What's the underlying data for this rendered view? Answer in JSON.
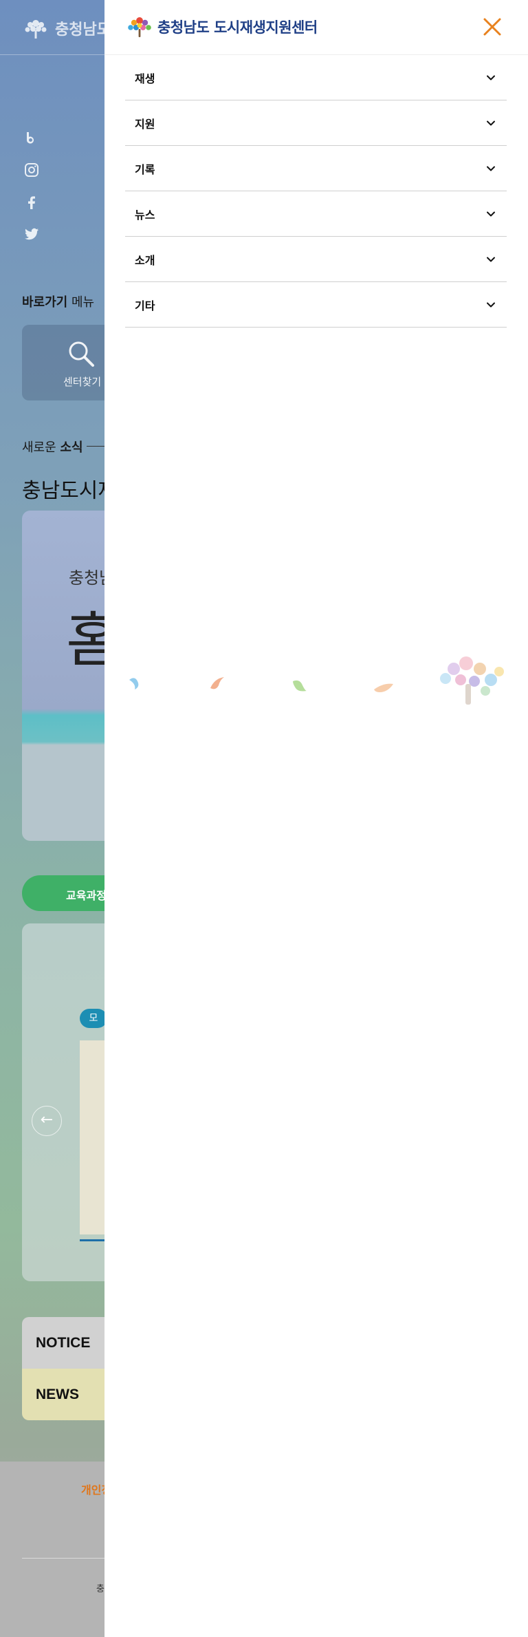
{
  "background": {
    "logo_text": "충청남도",
    "social_icons": [
      "blog-icon",
      "instagram-icon",
      "facebook-icon",
      "twitter-icon"
    ],
    "quick_title_bold": "바로가기",
    "quick_title_rest": " 메뉴",
    "quick_card_label": "센터찾기",
    "news_title_normal": "새로운 ",
    "news_title_bold": "소식",
    "big_title": "충남도시재",
    "banner_line1": "충청남",
    "banner_line2": "홈",
    "green_button": "교육과정",
    "edu_badge": "모",
    "tabs": [
      "NOTICE",
      "NEWS"
    ],
    "footer_privacy": "개인정",
    "footer_address": "충"
  },
  "panel": {
    "brand_name": "충청남도 도시재생지원센터",
    "close_icon": "close-icon",
    "menu": [
      {
        "label": "재생"
      },
      {
        "label": "지원"
      },
      {
        "label": "기록"
      },
      {
        "label": "뉴스"
      },
      {
        "label": "소개"
      },
      {
        "label": "기타"
      }
    ]
  },
  "colors": {
    "accent_orange": "#e8821e",
    "brand_navy": "#1f3f86",
    "notice_tab": "#d1d1d1",
    "news_tab": "#e3e0b2",
    "green_button": "#3fb067"
  }
}
